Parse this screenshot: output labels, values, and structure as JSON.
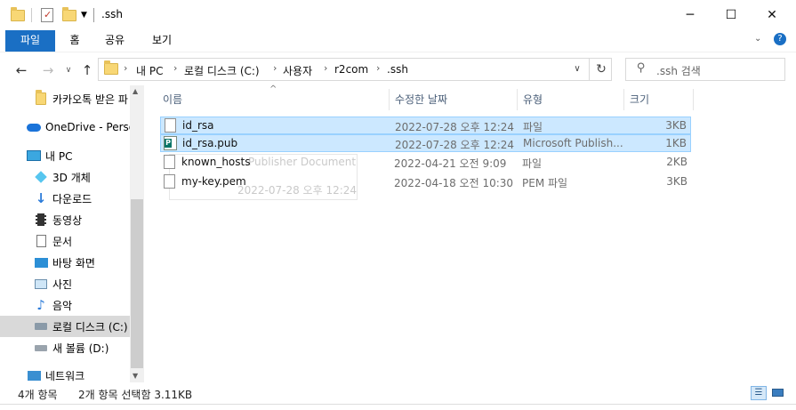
{
  "window": {
    "title": ".ssh",
    "controls": {
      "minimize": "─",
      "maximize": "☐",
      "close": "✕"
    }
  },
  "ribbon": {
    "tabs": [
      {
        "label": "파일"
      },
      {
        "label": "홈"
      },
      {
        "label": "공유"
      },
      {
        "label": "보기"
      }
    ]
  },
  "address": {
    "breadcrumbs": [
      "내 PC",
      "로컬 디스크 (C:)",
      "사용자",
      "r2com",
      ".ssh"
    ],
    "search_placeholder": ".ssh 검색"
  },
  "sidebar": {
    "items": [
      {
        "label": "카카오톡 받은 파",
        "icon": "folder-icon"
      },
      {
        "label": "OneDrive - Person",
        "icon": "cloud-icon"
      },
      {
        "label": "내 PC",
        "icon": "computer-icon"
      },
      {
        "label": "3D 개체",
        "icon": "3d-objects-icon"
      },
      {
        "label": "다운로드",
        "icon": "download-icon"
      },
      {
        "label": "동영상",
        "icon": "video-icon"
      },
      {
        "label": "문서",
        "icon": "document-icon"
      },
      {
        "label": "바탕 화면",
        "icon": "desktop-icon"
      },
      {
        "label": "사진",
        "icon": "pictures-icon"
      },
      {
        "label": "음악",
        "icon": "music-icon"
      },
      {
        "label": "로컬 디스크 (C:)",
        "icon": "local-disk-icon"
      },
      {
        "label": "새 볼륨 (D:)",
        "icon": "drive-icon"
      },
      {
        "label": "네트워크",
        "icon": "network-icon"
      }
    ]
  },
  "columns": {
    "name": "이름",
    "modified": "수정한 날짜",
    "type": "유형",
    "size": "크기"
  },
  "files": [
    {
      "name": "id_rsa",
      "modified": "2022-07-28 오후 12:24",
      "type": "파일",
      "size": "3KB",
      "selected": true,
      "icon": "file-icon"
    },
    {
      "name": "id_rsa.pub",
      "modified": "2022-07-28 오후 12:24",
      "type": "Microsoft Publish...",
      "size": "1KB",
      "selected": true,
      "icon": "publisher-file-icon"
    },
    {
      "name": "known_hosts",
      "modified": "2022-04-21 오전 9:09",
      "type": "파일",
      "size": "2KB",
      "selected": false,
      "icon": "file-icon"
    },
    {
      "name": "my-key.pem",
      "modified": "2022-04-18 오전 10:30",
      "type": "PEM 파일",
      "size": "3KB",
      "selected": false,
      "icon": "file-icon"
    }
  ],
  "tooltip_ghost": {
    "line1": "Publisher Document",
    "line2": "2022-07-28 오후 12:24"
  },
  "status": {
    "item_count": "4개 항목",
    "selection": "2개 항목 선택함 3.11KB"
  },
  "colors": {
    "accent": "#1a6fc4",
    "selection_bg": "#cce8ff",
    "selection_border": "#99d1ff",
    "header_text": "#4c607a"
  }
}
